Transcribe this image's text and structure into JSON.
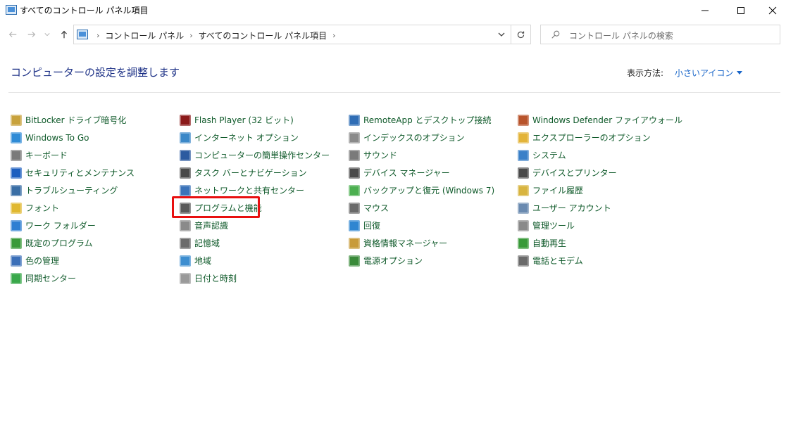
{
  "window": {
    "title": "すべてのコントロール パネル項目"
  },
  "address": {
    "crumbs": [
      "コントロール パネル",
      "すべてのコントロール パネル項目"
    ]
  },
  "search": {
    "placeholder": "コントロール パネルの検索"
  },
  "header": {
    "title": "コンピューターの設定を調整します",
    "view_by_label": "表示方法:",
    "view_by_value": "小さいアイコン"
  },
  "columns": [
    [
      {
        "label": "BitLocker ドライブ暗号化",
        "icon": "bitlocker-icon",
        "color": "#c8a23c"
      },
      {
        "label": "Windows To Go",
        "icon": "windows-to-go-icon",
        "color": "#2e8bd6"
      },
      {
        "label": "キーボード",
        "icon": "keyboard-icon",
        "color": "#7a7a7a"
      },
      {
        "label": "セキュリティとメンテナンス",
        "icon": "security-flag-icon",
        "color": "#1d5fbf"
      },
      {
        "label": "トラブルシューティング",
        "icon": "troubleshooting-icon",
        "color": "#3a6ea5"
      },
      {
        "label": "フォント",
        "icon": "font-icon",
        "color": "#e0b830"
      },
      {
        "label": "ワーク フォルダー",
        "icon": "work-folders-icon",
        "color": "#2d7fd2"
      },
      {
        "label": "既定のプログラム",
        "icon": "default-programs-icon",
        "color": "#3a9a3a"
      },
      {
        "label": "色の管理",
        "icon": "color-management-icon",
        "color": "#3b6fb8"
      },
      {
        "label": "同期センター",
        "icon": "sync-center-icon",
        "color": "#39a84a"
      }
    ],
    [
      {
        "label": "Flash Player (32 ビット)",
        "icon": "flash-player-icon",
        "color": "#8b1a1a"
      },
      {
        "label": "インターネット オプション",
        "icon": "internet-options-icon",
        "color": "#3b88c8"
      },
      {
        "label": "コンピューターの簡単操作センター",
        "icon": "ease-of-access-icon",
        "color": "#2c5aa0"
      },
      {
        "label": "タスク バーとナビゲーション",
        "icon": "taskbar-icon",
        "color": "#4a4a4a"
      },
      {
        "label": "ネットワークと共有センター",
        "icon": "network-icon",
        "color": "#3b73b9"
      },
      {
        "label": "プログラムと機能",
        "icon": "programs-features-icon",
        "color": "#5a5a5a"
      },
      {
        "label": "音声認識",
        "icon": "microphone-icon",
        "color": "#8a8a8a"
      },
      {
        "label": "記憶域",
        "icon": "storage-spaces-icon",
        "color": "#6b6b6b"
      },
      {
        "label": "地域",
        "icon": "region-icon",
        "color": "#3d8ed0"
      },
      {
        "label": "日付と時刻",
        "icon": "date-time-icon",
        "color": "#9a9a9a"
      }
    ],
    [
      {
        "label": "RemoteApp とデスクトップ接続",
        "icon": "remoteapp-icon",
        "color": "#2f6db5"
      },
      {
        "label": "インデックスのオプション",
        "icon": "indexing-icon",
        "color": "#8a8a8a"
      },
      {
        "label": "サウンド",
        "icon": "sound-icon",
        "color": "#7a7a7a"
      },
      {
        "label": "デバイス マネージャー",
        "icon": "device-manager-icon",
        "color": "#4a4a4a"
      },
      {
        "label": "バックアップと復元 (Windows 7)",
        "icon": "backup-restore-icon",
        "color": "#4caf50"
      },
      {
        "label": "マウス",
        "icon": "mouse-icon",
        "color": "#6a6a6a"
      },
      {
        "label": "回復",
        "icon": "recovery-icon",
        "color": "#2f86d1"
      },
      {
        "label": "資格情報マネージャー",
        "icon": "credential-manager-icon",
        "color": "#c89b3a"
      },
      {
        "label": "電源オプション",
        "icon": "power-options-icon",
        "color": "#3a8a3a"
      }
    ],
    [
      {
        "label": "Windows Defender ファイアウォール",
        "icon": "firewall-icon",
        "color": "#b8542c"
      },
      {
        "label": "エクスプローラーのオプション",
        "icon": "explorer-options-icon",
        "color": "#e3b43a"
      },
      {
        "label": "システム",
        "icon": "system-icon",
        "color": "#3a80c8"
      },
      {
        "label": "デバイスとプリンター",
        "icon": "devices-printers-icon",
        "color": "#4a4a4a"
      },
      {
        "label": "ファイル履歴",
        "icon": "file-history-icon",
        "color": "#d8b440"
      },
      {
        "label": "ユーザー アカウント",
        "icon": "user-accounts-icon",
        "color": "#6a8ab0"
      },
      {
        "label": "管理ツール",
        "icon": "admin-tools-icon",
        "color": "#8a8a8a"
      },
      {
        "label": "自動再生",
        "icon": "autoplay-icon",
        "color": "#3a9a3a"
      },
      {
        "label": "電話とモデム",
        "icon": "phone-modem-icon",
        "color": "#6a6a6a"
      }
    ]
  ],
  "highlighted_item": "プログラムと機能"
}
